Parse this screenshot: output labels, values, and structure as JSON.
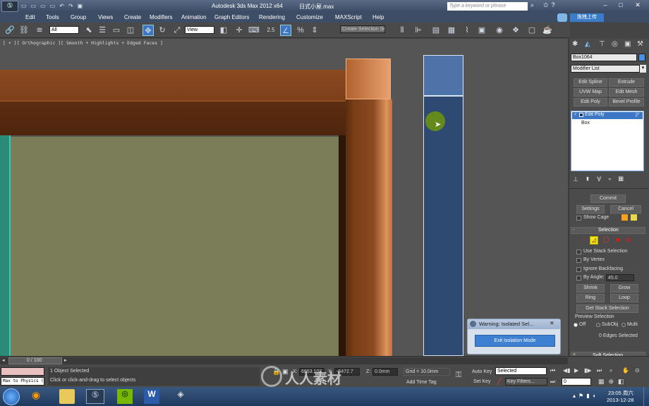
{
  "window": {
    "app_title": "Autodesk 3ds Max  2012 x64",
    "file_name": "日式小屋.max",
    "search_placeholder": "Type a keyword or phrase",
    "upload_label": "拖拽上传"
  },
  "menu": [
    "Edit",
    "Tools",
    "Group",
    "Views",
    "Create",
    "Modifiers",
    "Animation",
    "Graph Editors",
    "Rendering",
    "Customize",
    "MAXScript",
    "Help"
  ],
  "toolbar": {
    "selection_filter": "All",
    "ref_coord": "View",
    "snap_label": "2.5",
    "named_selection": "Create Selection Se"
  },
  "viewport": {
    "label": "[ + ][ Orthographic ][ Smooth + Highlights + Edged Faces ]"
  },
  "command_panel": {
    "object_name": "Box1064",
    "modifier_list": "Modifier List",
    "buttons": [
      "Edit Spline",
      "Extrude",
      "UVW Map",
      "Edit Mesh",
      "Edit Poly",
      "Bevel Profile"
    ],
    "stack": [
      "Edit Poly",
      "Box"
    ],
    "commit": "Commit",
    "settings": "Settings",
    "cancel": "Cancel",
    "show_cage": "Show Cage",
    "rollout_selection": "Selection",
    "use_stack_selection": "Use Stack Selection",
    "by_vertex": "By Vertex",
    "ignore_backfacing": "Ignore Backfacing",
    "by_angle": "By Angle:",
    "angle_value": "45.0",
    "shrink": "Shrink",
    "grow": "Grow",
    "ring": "Ring",
    "loop": "Loop",
    "get_stack_selection": "Get Stack Selection",
    "preview_selection": "Preview Selection",
    "preview_options": [
      "Off",
      "SubObj",
      "Multi"
    ],
    "edges_selected": "0 Edges Selected",
    "soft_selection": "Soft Selection"
  },
  "dialog": {
    "title": "Warning: Isolated Sel...",
    "button": "Exit Isolation Mode"
  },
  "status": {
    "time_slider": "0 / 100",
    "maxscript_listener": "Max to Physics (",
    "objects_selected": "1 Object Selected",
    "prompt": "Click or click-and-drag to select objects",
    "x_label": "X:",
    "x_value": "6653.103",
    "y_label": "Y:",
    "y_value": "-6472.7",
    "z_label": "Z:",
    "z_value": "0.0mm",
    "grid": "Grid = 10.0mm",
    "add_time_tag": "Add Time Tag",
    "auto_key": "Auto Key",
    "selected": "Selected",
    "set_key": "Set Key",
    "key_filters": "Key Filters...",
    "frame": "0"
  },
  "taskbar": {
    "time": "23:05 周六",
    "date": "2013-12-28",
    "watermark": "人人素材"
  },
  "colors": {
    "wood_light": "#e0935c",
    "wood_dark": "#6b3516",
    "wall": "#7a7d58",
    "highlight_box": "#2f4a72",
    "dialog_button": "#3d7fd0"
  }
}
